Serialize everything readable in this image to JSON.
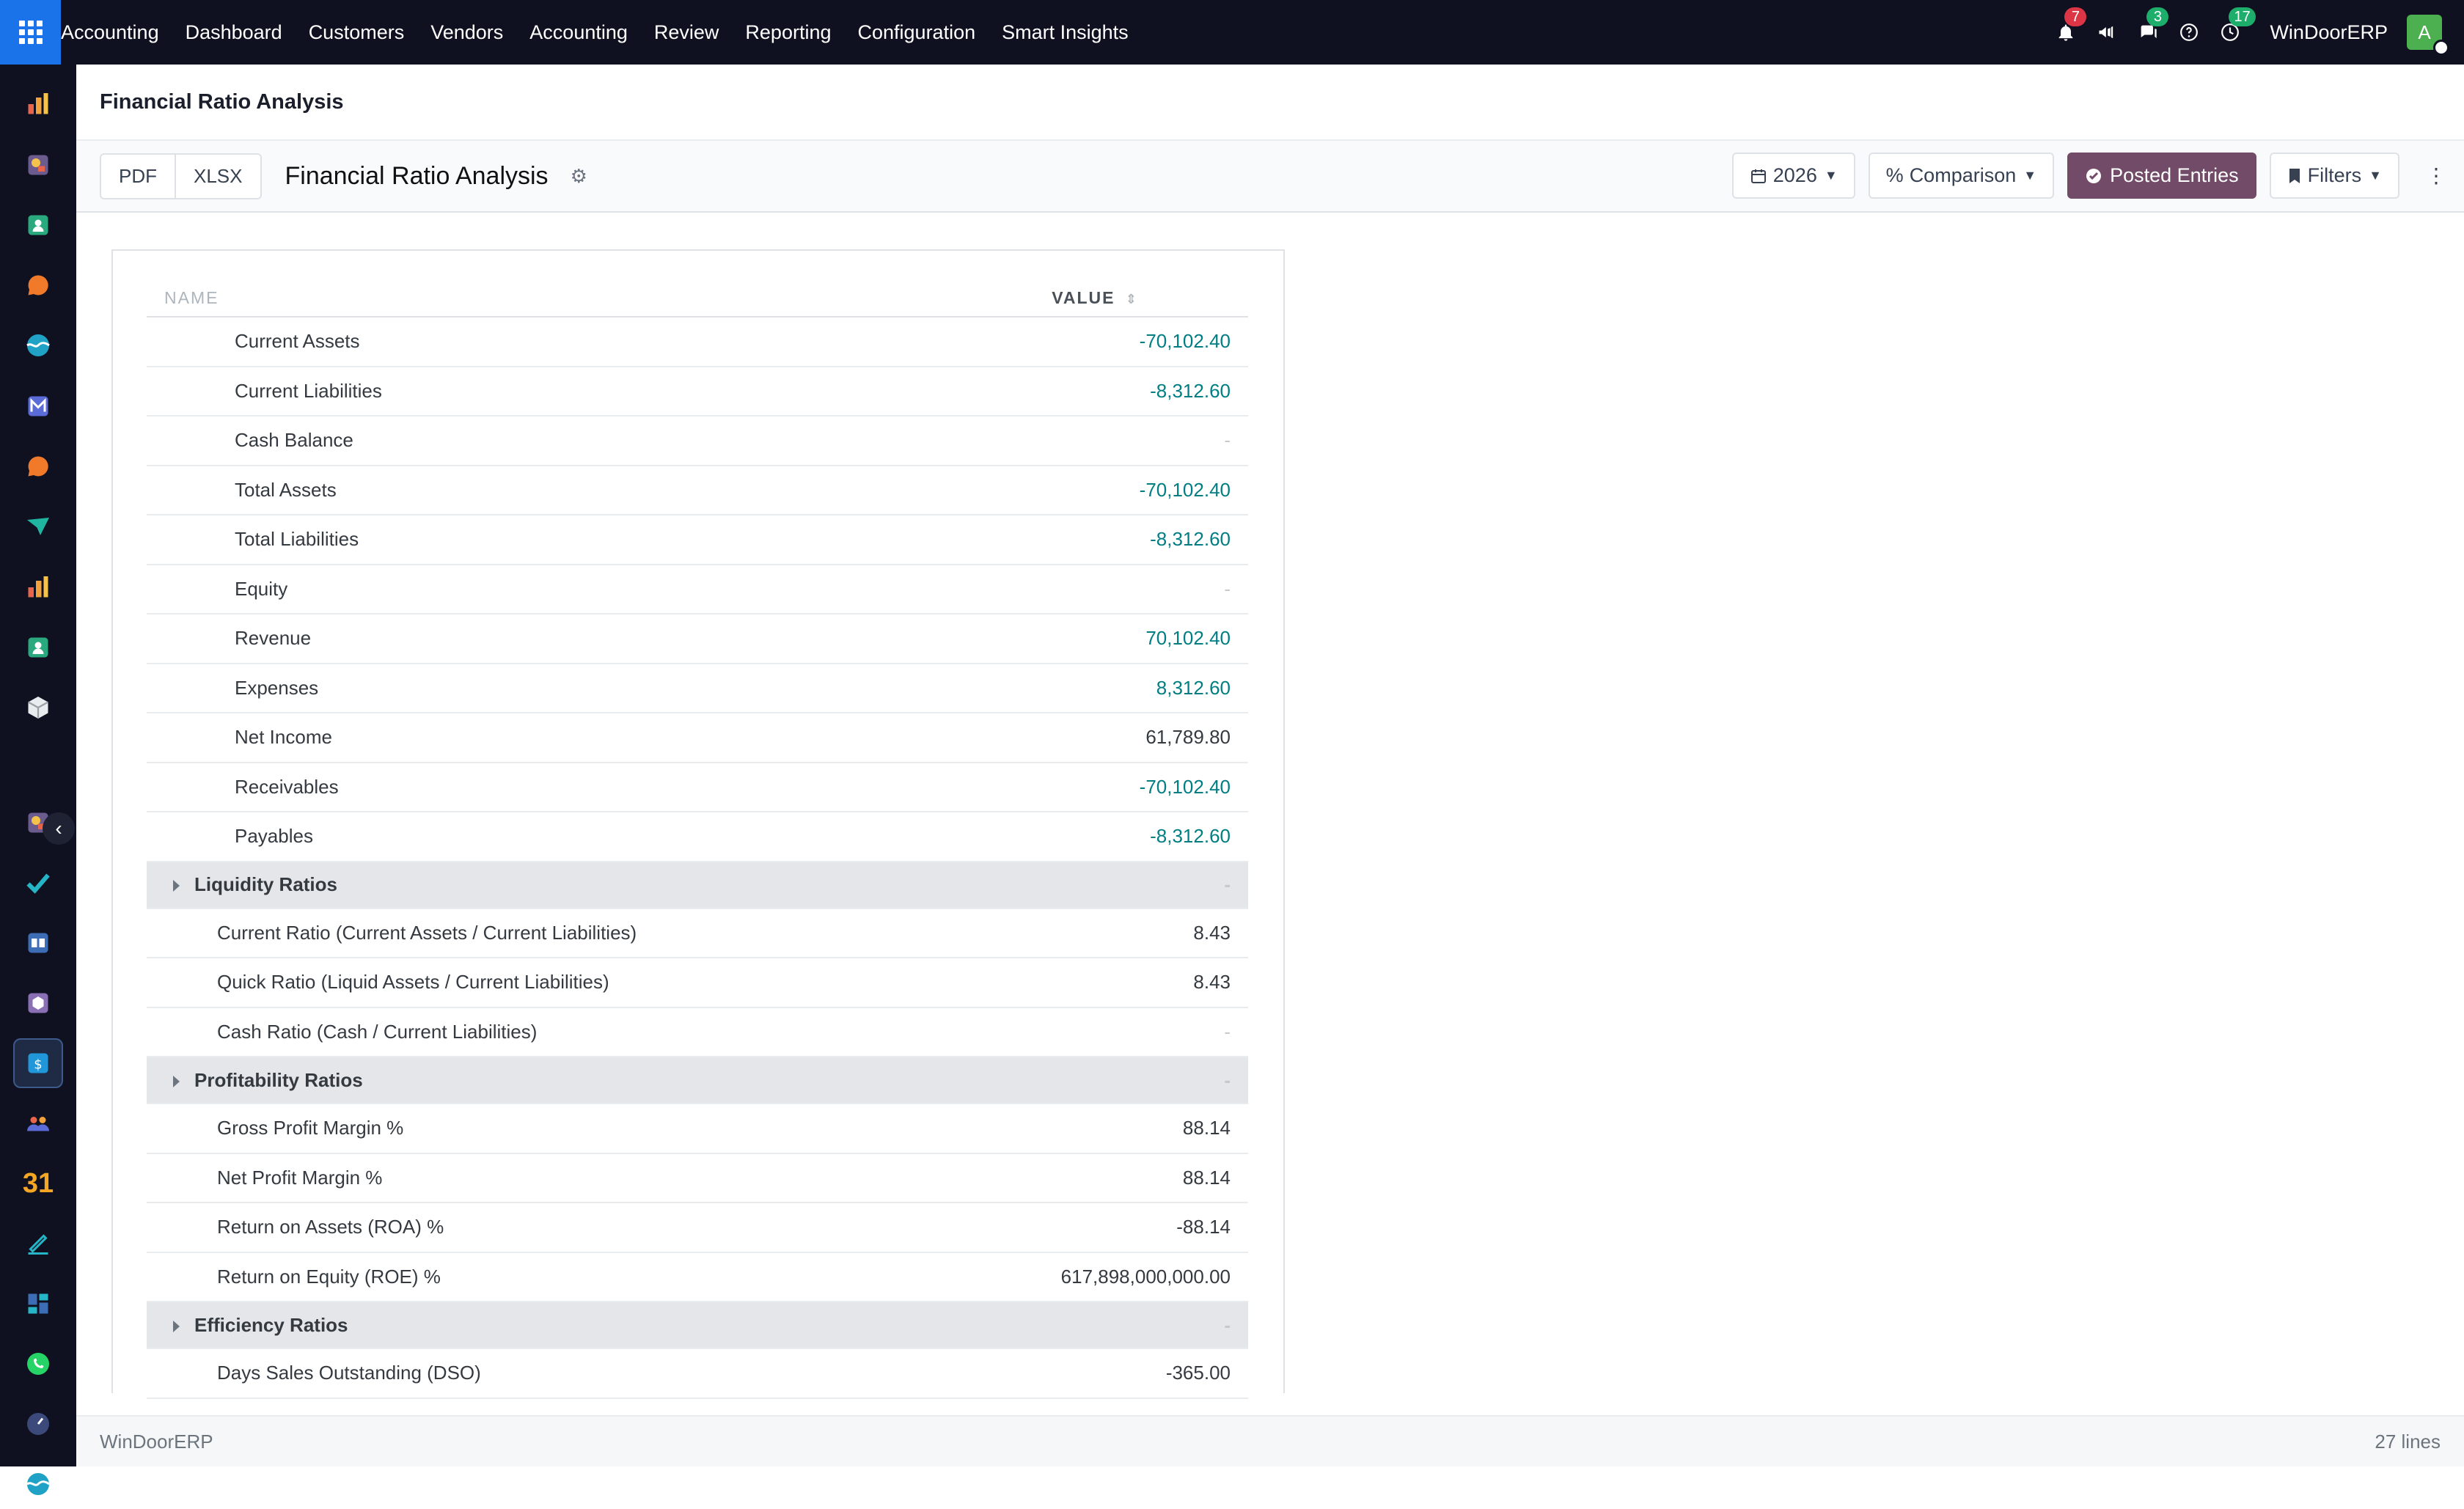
{
  "topbar": {
    "app_name": "Accounting",
    "menu": [
      "Dashboard",
      "Customers",
      "Vendors",
      "Accounting",
      "Review",
      "Reporting",
      "Configuration",
      "Smart Insights"
    ],
    "badges": {
      "notifications": "7",
      "messages": "3",
      "activities": "17"
    },
    "company": "WinDoorERP",
    "avatar_letter": "A"
  },
  "breadcrumb": {
    "title": "Financial Ratio Analysis"
  },
  "control": {
    "export": [
      "PDF",
      "XLSX"
    ],
    "report_title": "Financial Ratio Analysis",
    "date_filter": "2026",
    "comparison": "Comparison",
    "posted": "Posted Entries",
    "filters": "Filters"
  },
  "table": {
    "headers": {
      "name": "NAME",
      "value": "VALUE"
    },
    "rows": [
      {
        "name": "Current Assets",
        "value": "-70,102.40",
        "style": "teal",
        "level": 1
      },
      {
        "name": "Current Liabilities",
        "value": "-8,312.60",
        "style": "teal",
        "level": 1
      },
      {
        "name": "Cash Balance",
        "value": "-",
        "style": "muted",
        "level": 1
      },
      {
        "name": "Total Assets",
        "value": "-70,102.40",
        "style": "teal",
        "level": 1
      },
      {
        "name": "Total Liabilities",
        "value": "-8,312.60",
        "style": "teal",
        "level": 1
      },
      {
        "name": "Equity",
        "value": "-",
        "style": "muted",
        "level": 1
      },
      {
        "name": "Revenue",
        "value": "70,102.40",
        "style": "teal",
        "level": 1
      },
      {
        "name": "Expenses",
        "value": "8,312.60",
        "style": "teal",
        "level": 1
      },
      {
        "name": "Net Income",
        "value": "61,789.80",
        "style": "normal",
        "level": 1
      },
      {
        "name": "Receivables",
        "value": "-70,102.40",
        "style": "teal",
        "level": 1
      },
      {
        "name": "Payables",
        "value": "-8,312.60",
        "style": "teal",
        "level": 1
      },
      {
        "name": "Liquidity Ratios",
        "value": "-",
        "style": "group"
      },
      {
        "name": "Current Ratio (Current Assets / Current Liabilities)",
        "value": "8.43",
        "style": "normal",
        "level": 2
      },
      {
        "name": "Quick Ratio (Liquid Assets / Current Liabilities)",
        "value": "8.43",
        "style": "normal",
        "level": 2
      },
      {
        "name": "Cash Ratio (Cash / Current Liabilities)",
        "value": "-",
        "style": "muted",
        "level": 2
      },
      {
        "name": "Profitability Ratios",
        "value": "-",
        "style": "group"
      },
      {
        "name": "Gross Profit Margin %",
        "value": "88.14",
        "style": "normal",
        "level": 2
      },
      {
        "name": "Net Profit Margin %",
        "value": "88.14",
        "style": "normal",
        "level": 2
      },
      {
        "name": "Return on Assets (ROA) %",
        "value": "-88.14",
        "style": "normal",
        "level": 2
      },
      {
        "name": "Return on Equity (ROE) %",
        "value": "617,898,000,000.00",
        "style": "normal",
        "level": 2
      },
      {
        "name": "Efficiency Ratios",
        "value": "-",
        "style": "group"
      },
      {
        "name": "Days Sales Outstanding (DSO)",
        "value": "-365.00",
        "style": "normal",
        "level": 2
      }
    ]
  },
  "footer": {
    "company": "WinDoorERP",
    "lines": "27 lines"
  },
  "colors": {
    "topbar": "#0f1120",
    "accent": "#1a73e8",
    "primary_button": "#714b67",
    "teal": "#017e84"
  }
}
